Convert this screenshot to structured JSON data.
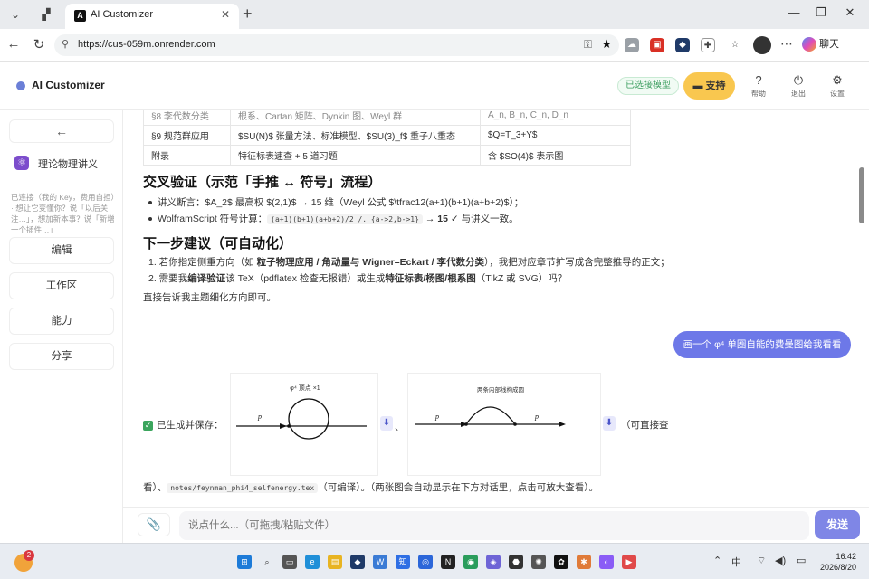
{
  "browser": {
    "tab_title": "AI Customizer",
    "url": "https://cus-059m.onrender.com",
    "chat_label": "聊天"
  },
  "header": {
    "brand": "AI Customizer",
    "model_badge": "已选接模型",
    "support": "支持",
    "help": "帮助",
    "logout": "退出",
    "settings": "设置"
  },
  "sidebar": {
    "back": "←",
    "project": "理论物理讲义",
    "desc": "已连接（我的 Key，费用自担）· 想让它变懂你？说「以后关注…」，想加新本事？说「新增一个插件…」",
    "buttons": [
      "编辑",
      "工作区",
      "能力",
      "分享"
    ]
  },
  "table": [
    [
      "§9 规范群应用",
      "$SU(N)$ 张量方法、标准模型、$SU(3)_f$ 重子八重态",
      "$Q=T_3+Y$"
    ],
    [
      "附录",
      "特征标表速查 + 5 道习题",
      "含 $SO(4)$ 表示图"
    ]
  ],
  "section1": {
    "title": "交叉验证（示范「手推 ↔ 符号」流程）",
    "bullet1": "讲义断言：$A_2$ 最高权 $(2,1)$ → 15 维（Weyl 公式 $\\tfrac12(a+1)(b+1)(a+b+2)$）；",
    "bullet2_pre": "WolframScript 符号计算：",
    "bullet2_code": "(a+1)(b+1)(a+b+2)/2 /. {a->2,b->1}",
    "bullet2_arrow": " → ",
    "bullet2_result": "15",
    "bullet2_post": " ✓ 与讲义一致。"
  },
  "section2": {
    "title": "下一步建议（可自动化）",
    "item1_a": "1. 若你指定侧重方向（如 ",
    "item1_b": "粒子物理应用 / 角动量与 Wigner–Eckart / 李代数分类",
    "item1_c": "），我把对应章节扩写成含完整推导的正文；",
    "item2_a": "2. 需要我",
    "item2_b": "编译验证",
    "item2_c": "该 TeX（pdflatex 检查无报错）或生成",
    "item2_d": "特征标表/杨图/根系图",
    "item2_e": "（TikZ 或 SVG）吗？",
    "closing": "直接告诉我主题细化方向即可。"
  },
  "user_message": "画一个 φ⁴ 单圈自能的费曼图给我看看",
  "reply": {
    "saved": "已生成并保存：",
    "sep": "、",
    "after_fig2": "（可直接查",
    "line2_a": "看）、",
    "line2_code": "notes/feynman_phi4_selfenergy.tex",
    "line2_b": "（可编译）。（两张图会自动显示在下方对话里，点击可放大查看）。",
    "fig1": {
      "title": "φ⁴ 顶点 ×1",
      "label": "p"
    },
    "fig2": {
      "title": "两条内部线构成圆",
      "label_left": "p",
      "label_right": "p"
    }
  },
  "composer": {
    "attach": "📎",
    "placeholder": "说点什么...（可拖拽/粘贴文件）",
    "send": "发送"
  },
  "taskbar": {
    "badge": "2",
    "lang": "中",
    "time": "16:42",
    "date": "2026/8/20"
  }
}
